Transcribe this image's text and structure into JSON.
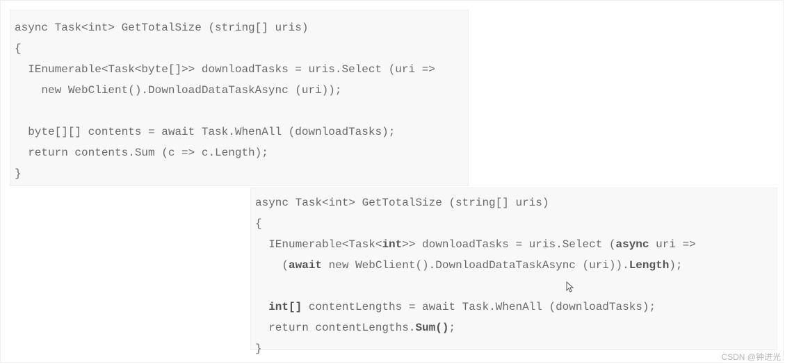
{
  "block1": {
    "l1": "async Task<int> GetTotalSize (string[] uris)",
    "l2": "{",
    "l3": "  IEnumerable<Task<byte[]>> downloadTasks = uris.Select (uri =>",
    "l4": "    new WebClient().DownloadDataTaskAsync (uri));",
    "l5": "",
    "l6": "  byte[][] contents = await Task.WhenAll (downloadTasks);",
    "l7": "  return contents.Sum (c => c.Length);",
    "l8": "}"
  },
  "block2": {
    "l1": "async Task<int> GetTotalSize (string[] uris)",
    "l2": "{",
    "l3a": "  IEnumerable<Task<",
    "l3b": "int",
    "l3c": ">> downloadTasks = uris.Select (",
    "l3d": "async",
    "l3e": " uri =>",
    "l4a": "    (",
    "l4b": "await",
    "l4c": " new WebClient().DownloadDataTaskAsync (uri)).",
    "l4d": "Length",
    "l4e": ");",
    "l5": "",
    "l6a": "  ",
    "l6b": "int[]",
    "l6c": " contentLengths = await Task.WhenAll (downloadTasks);",
    "l7a": "  return contentLengths.",
    "l7b": "Sum()",
    "l7c": ";",
    "l8": "}"
  },
  "watermark": "CSDN @钟进光"
}
